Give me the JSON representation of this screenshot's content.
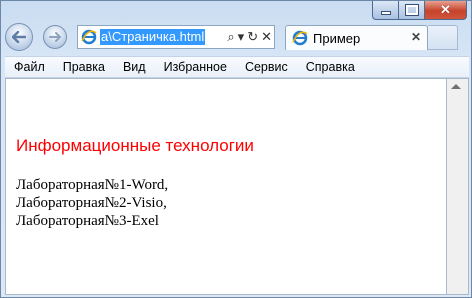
{
  "window": {
    "caption": {
      "minimize": "",
      "maximize": "",
      "close": "✕"
    }
  },
  "nav": {
    "back_icon": "back-arrow-icon",
    "forward_icon": "forward-arrow-icon",
    "address": {
      "text": "a\\Страничка.html",
      "tools": [
        "⌕",
        "▾",
        "↻",
        "✕"
      ]
    },
    "tab": {
      "label": "Пример",
      "close": "✕"
    }
  },
  "menubar": {
    "items": [
      "Файл",
      "Правка",
      "Вид",
      "Избранное",
      "Сервис",
      "Справка"
    ]
  },
  "page": {
    "heading": "Информационные технологии",
    "lines": [
      "Лабораторная№1-Word,",
      "Лабораторная№2-Visio,",
      "Лабораторная№3-Exel"
    ]
  },
  "colors": {
    "heading": "#ff0000",
    "selection": "#3399ff",
    "close_button": "#c6432b"
  }
}
